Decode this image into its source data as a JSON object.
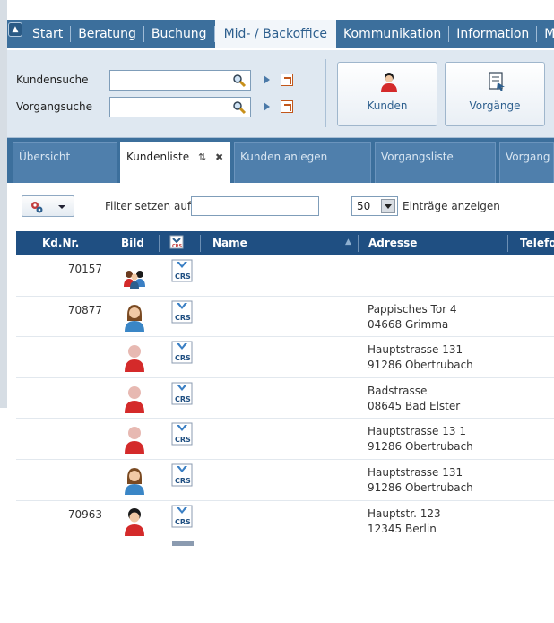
{
  "menu": {
    "items": [
      "Start",
      "Beratung",
      "Buchung",
      "Mid- / Backoffice",
      "Kommunikation",
      "Information",
      "Mein"
    ],
    "active": "Mid- / Backoffice",
    "colors": {
      "bar": "#3c6f9c",
      "active_bg": "#f2f6fa"
    }
  },
  "toolbar": {
    "customer_search_label": "Kundensuche",
    "customer_search_value": "",
    "process_search_label": "Vorgangsuche",
    "process_search_value": "",
    "buttons": [
      {
        "label": "Kunden",
        "icon": "customer-icon"
      },
      {
        "label": "Vorgänge",
        "icon": "process-document-icon"
      }
    ]
  },
  "tabs": [
    {
      "label": "Übersicht",
      "active": false
    },
    {
      "label": "Kundenliste",
      "active": true,
      "icons": [
        "refresh-icon",
        "close-icon"
      ]
    },
    {
      "label": "Kunden anlegen",
      "active": false
    },
    {
      "label": "Vorgangsliste",
      "active": false
    },
    {
      "label": "Vorgang a",
      "active": false
    }
  ],
  "listbar": {
    "filter_label": "Filter setzen auf",
    "filter_value": "",
    "per_page_value": "50",
    "entries_label": "Einträge anzeigen"
  },
  "table": {
    "columns": [
      "Kd.Nr.",
      "Bild",
      "",
      "Name",
      "Adresse",
      "Telefon"
    ],
    "rows": [
      {
        "kdnr": "70157",
        "image": "group-avatar-icon",
        "crs": "CRS",
        "name": "",
        "address_line1": "",
        "address_line2": ""
      },
      {
        "kdnr": "70877",
        "image": "female-avatar-icon",
        "crs": "CRS",
        "name": "",
        "address_line1": "Pappisches Tor 4",
        "address_line2": "04668 Grimma"
      },
      {
        "kdnr": "",
        "image": "default-avatar-icon",
        "crs": "CRS",
        "name": "",
        "address_line1": "Hauptstrasse 131",
        "address_line2": "91286 Obertrubach"
      },
      {
        "kdnr": "",
        "image": "default-avatar-icon",
        "crs": "CRS",
        "name": "",
        "address_line1": "Badstrasse",
        "address_line2": "08645 Bad Elster"
      },
      {
        "kdnr": "",
        "image": "default-avatar-icon",
        "crs": "CRS",
        "name": "",
        "address_line1": "Hauptstrasse 13 1",
        "address_line2": "91286 Obertrubach"
      },
      {
        "kdnr": "",
        "image": "female-avatar-icon",
        "crs": "CRS",
        "name": "",
        "address_line1": "Hauptstrasse 131",
        "address_line2": "91286 Obertrubach"
      },
      {
        "kdnr": "70963",
        "image": "male-avatar-icon",
        "crs": "CRS",
        "name": "",
        "address_line1": "Hauptstr. 123",
        "address_line2": "12345 Berlin"
      }
    ]
  }
}
